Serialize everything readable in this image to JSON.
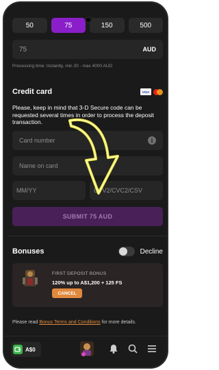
{
  "amounts": [
    "50",
    "75",
    "150",
    "500"
  ],
  "selected_amount_index": 1,
  "amount_field": {
    "value": "75",
    "currency": "AUD"
  },
  "processing_note": "Processing time: Instantly, min 20 - max 4000 AUD",
  "credit_card": {
    "title": "Credit card",
    "brand_icons": [
      "visa-icon",
      "mastercard-icon"
    ],
    "notice": "Please, keep in mind that 3-D Secure code can be requested several times in order to process the deposit transaction.",
    "card_number_placeholder": "Card number",
    "name_placeholder": "Name on card",
    "expiry_placeholder": "MM/YY",
    "cvv_placeholder": "CVV2/CVC2/CSV"
  },
  "submit_label": "SUBMIT 75 AUD",
  "bonuses": {
    "title": "Bonuses",
    "toggle_label": "Decline",
    "toggle_on": false,
    "card_label": "FIRST DEPOSIT BONUS",
    "card_description": "120% up to A$1,200 + 125 FS",
    "cancel_label": "CANCEL"
  },
  "terms": {
    "prefix": "Please read ",
    "link": "Bonus Terms and Conditions",
    "suffix": " for more details."
  },
  "bottom_bar": {
    "balance": "A$0",
    "icons": [
      "wallet-icon",
      "avatar",
      "bell-icon",
      "search-icon",
      "menu-icon"
    ]
  },
  "colors": {
    "accent_purple": "#8a1fc9",
    "submit_disabled": "#4a2058",
    "cancel_orange": "#e08a3e",
    "arrow_yellow": "#f5f04a"
  }
}
